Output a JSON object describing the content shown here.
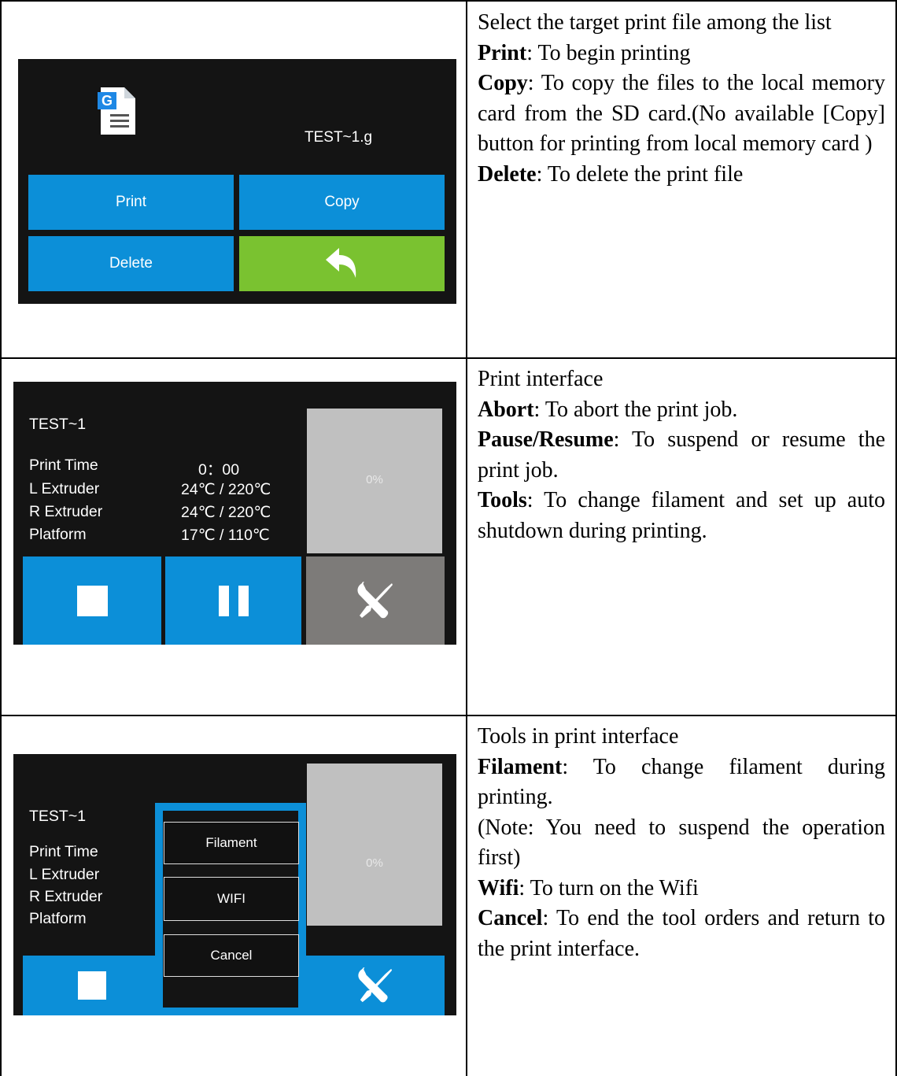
{
  "rows": [
    {
      "screen": {
        "file_name": "TEST~1.g",
        "file_icon_letter": "G",
        "buttons": {
          "print": "Print",
          "copy": "Copy",
          "delete": "Delete",
          "back_icon": "return-arrow-icon"
        },
        "colors": {
          "button_blue": "#0c8fd8",
          "button_green": "#7ac230",
          "background": "#141414"
        }
      },
      "description": {
        "intro": "Select the target print file among the list",
        "items": [
          {
            "term": "Print",
            "text": ": To begin printing"
          },
          {
            "term": "Copy",
            "text": ": To copy the files to the local memory card from the SD card.(No available [Copy] button for printing from local memory card )"
          },
          {
            "term": "Delete",
            "text": ": To delete the print file"
          }
        ]
      }
    },
    {
      "screen": {
        "title": "TEST~1",
        "stats": [
          {
            "label": "Print Time",
            "value": "0：00"
          },
          {
            "label": "L Extruder",
            "value": "24℃ / 220℃"
          },
          {
            "label": "R Extruder",
            "value": "24℃ / 220℃"
          },
          {
            "label": "Platform",
            "value": "17℃ / 110℃"
          }
        ],
        "progress": "0%",
        "buttons": [
          "stop-icon",
          "pause-icon",
          "tools-icon"
        ]
      },
      "description": {
        "intro": "Print interface",
        "items": [
          {
            "term": "Abort",
            "text": ": To abort the print job."
          },
          {
            "term": "Pause/Resume",
            "text": ": To suspend or resume the print job."
          },
          {
            "term": "Tools",
            "text": ": To change filament and set up auto shutdown during printing."
          }
        ]
      }
    },
    {
      "screen": {
        "title": "TEST~1",
        "stat_labels": [
          "Print Time",
          "L Extruder",
          "R Extruder",
          "Platform"
        ],
        "progress": "0%",
        "menu": [
          "Filament",
          "WIFI",
          "Cancel"
        ]
      },
      "description": {
        "intro": "Tools in print interface",
        "items": [
          {
            "term": "Filament",
            "text": ": To change filament during printing."
          },
          {
            "term": "",
            "text": "(Note: You need to suspend the operation first)"
          },
          {
            "term": "Wifi",
            "text": ": To turn on the Wifi"
          },
          {
            "term": "Cancel",
            "text": ": To end the tool orders and return to the print interface."
          }
        ]
      }
    }
  ]
}
